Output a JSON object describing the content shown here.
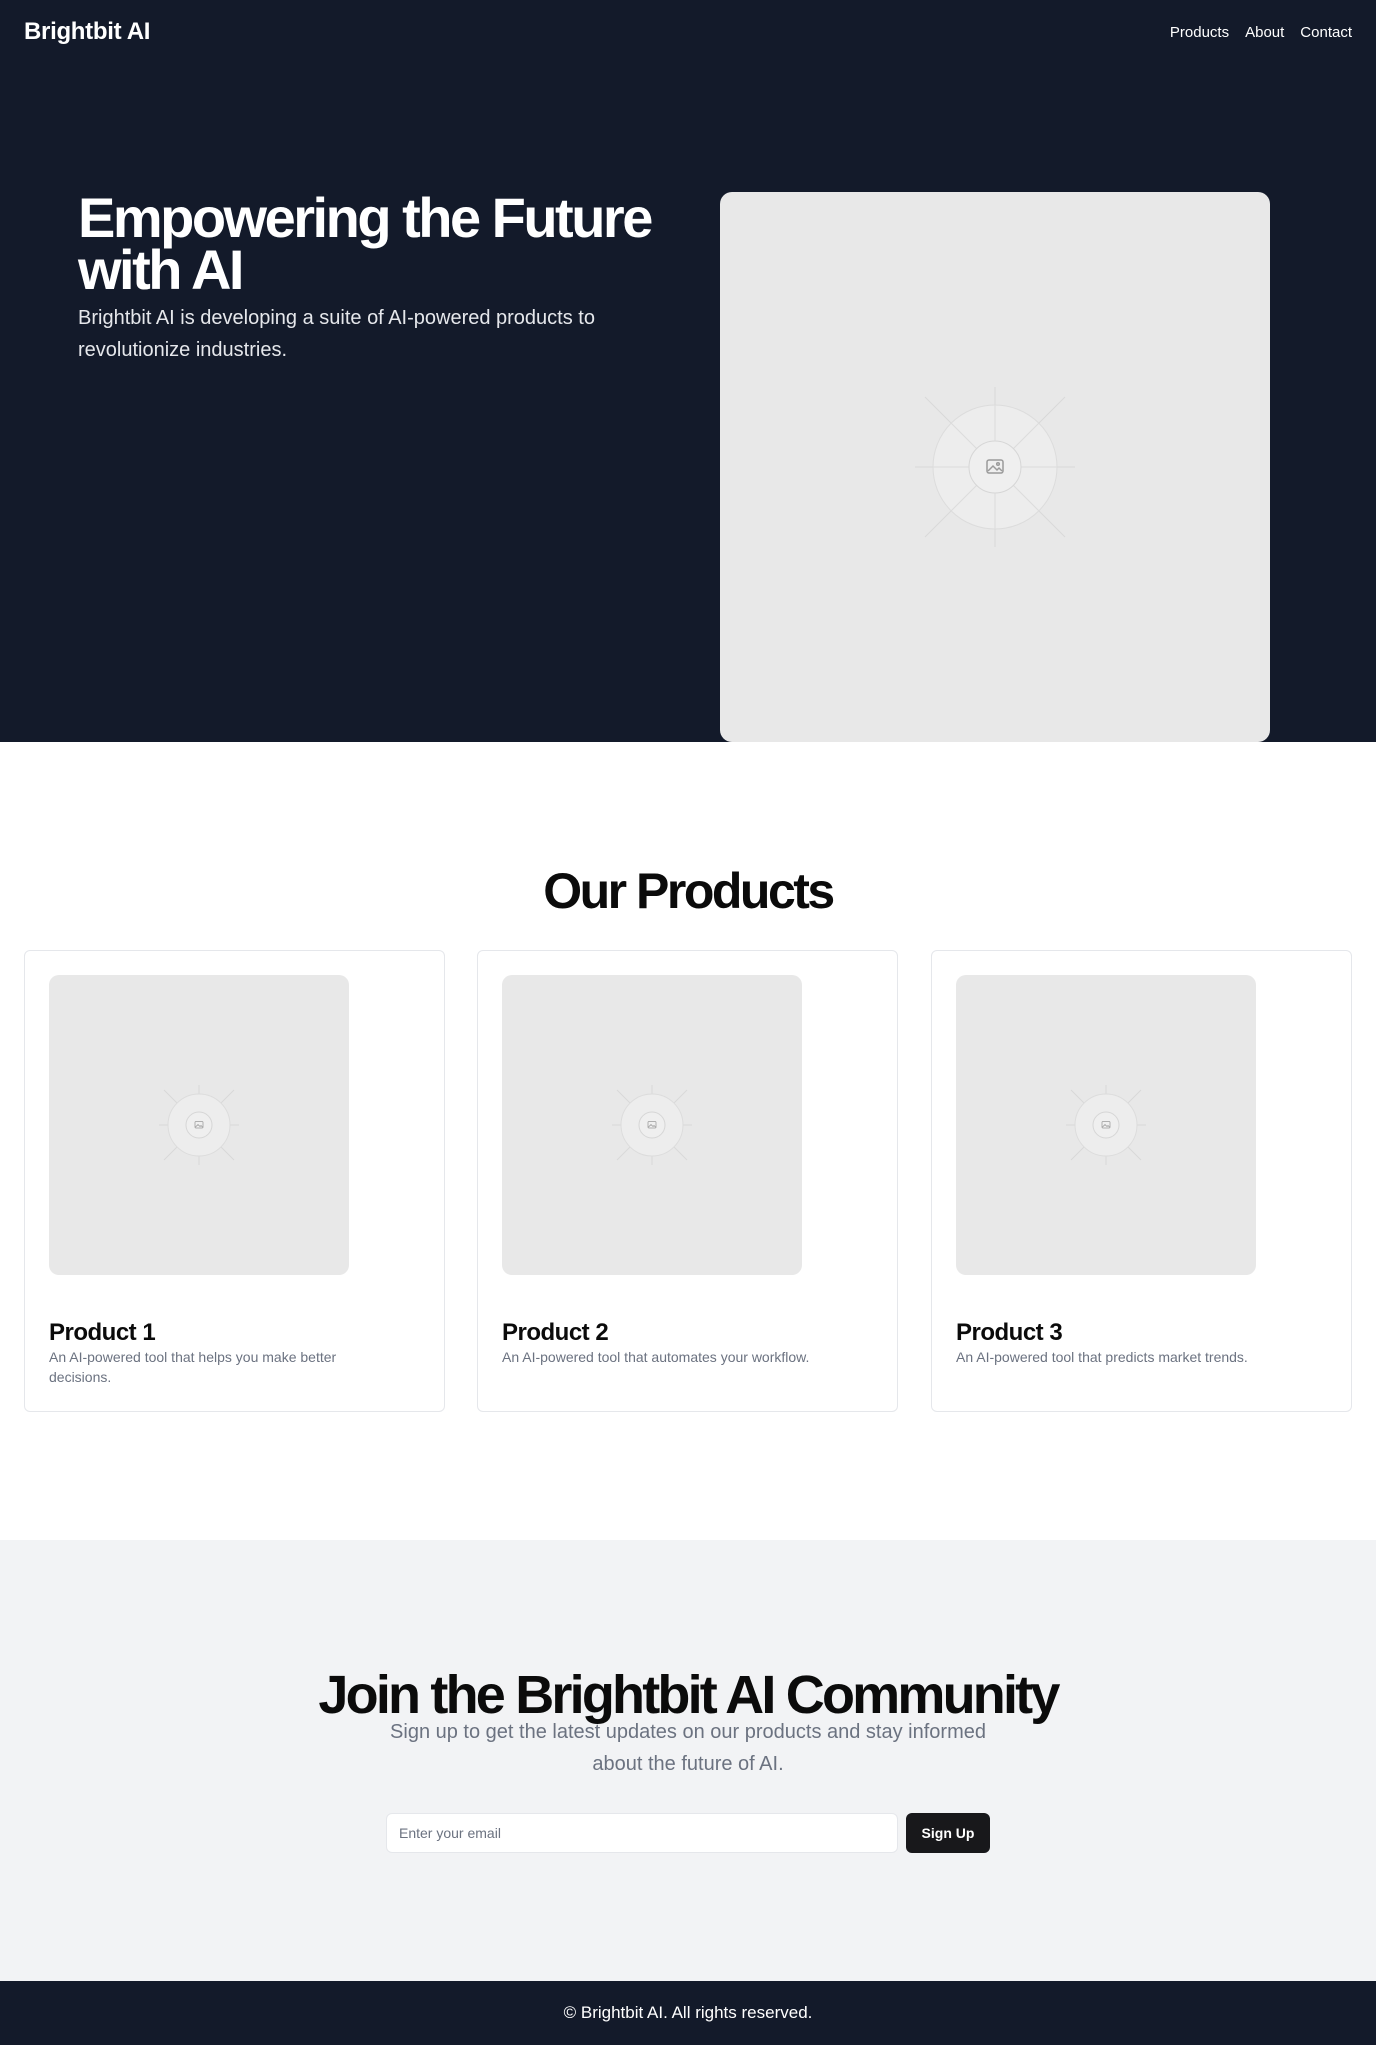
{
  "header": {
    "brand": "Brightbit AI",
    "nav": [
      "Products",
      "About",
      "Contact"
    ]
  },
  "hero": {
    "title": "Empowering the Future with AI",
    "subtitle": "Brightbit AI is developing a suite of AI-powered products to revolutionize industries.",
    "image_icon": "image-placeholder-icon"
  },
  "products": {
    "title": "Our Products",
    "items": [
      {
        "name": "Product 1",
        "description": "An AI-powered tool that helps you make better decisions.",
        "image_icon": "image-placeholder-icon"
      },
      {
        "name": "Product 2",
        "description": "An AI-powered tool that automates your workflow.",
        "image_icon": "image-placeholder-icon"
      },
      {
        "name": "Product 3",
        "description": "An AI-powered tool that predicts market trends.",
        "image_icon": "image-placeholder-icon"
      }
    ]
  },
  "community": {
    "title": "Join the Brightbit AI Community",
    "subtitle": "Sign up to get the latest updates on our products and stay informed about the future of AI.",
    "email_placeholder": "Enter your email",
    "button_label": "Sign Up"
  },
  "footer": {
    "text": "© Brightbit AI. All rights reserved."
  },
  "colors": {
    "dark_bg": "#131a2a",
    "placeholder_bg": "#e8e8e8",
    "community_bg": "#f2f3f5",
    "button_bg": "#18181b"
  }
}
